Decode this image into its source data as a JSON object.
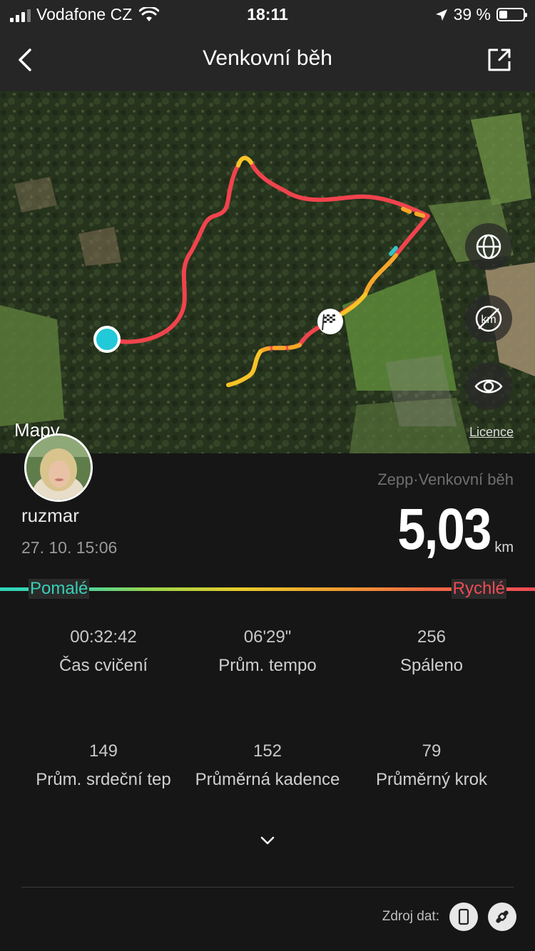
{
  "status_bar": {
    "carrier": "Vodafone CZ",
    "time": "18:11",
    "battery": "39 %"
  },
  "nav": {
    "title": "Venkovní běh"
  },
  "map": {
    "brand": "Mapy",
    "licence": "Licence"
  },
  "workout": {
    "source": "Zepp·Venkovní běh",
    "username": "ruzmar",
    "datetime": "27. 10. 15:06",
    "distance": "5,03",
    "distance_unit": "km"
  },
  "speed_legend": {
    "slow": "Pomalé",
    "fast": "Rychlé"
  },
  "stats": [
    {
      "value": "00:32:42",
      "label": "Čas cvičení"
    },
    {
      "value": "06'29\"",
      "label": "Prům. tempo"
    },
    {
      "value": "256",
      "label": "Spáleno"
    },
    {
      "value": "149",
      "label": "Prům. srdeční tep"
    },
    {
      "value": "152",
      "label": "Průměrná kadence"
    },
    {
      "value": "79",
      "label": "Průměrný krok"
    }
  ],
  "footer": {
    "data_source_label": "Zdroj dat:"
  }
}
